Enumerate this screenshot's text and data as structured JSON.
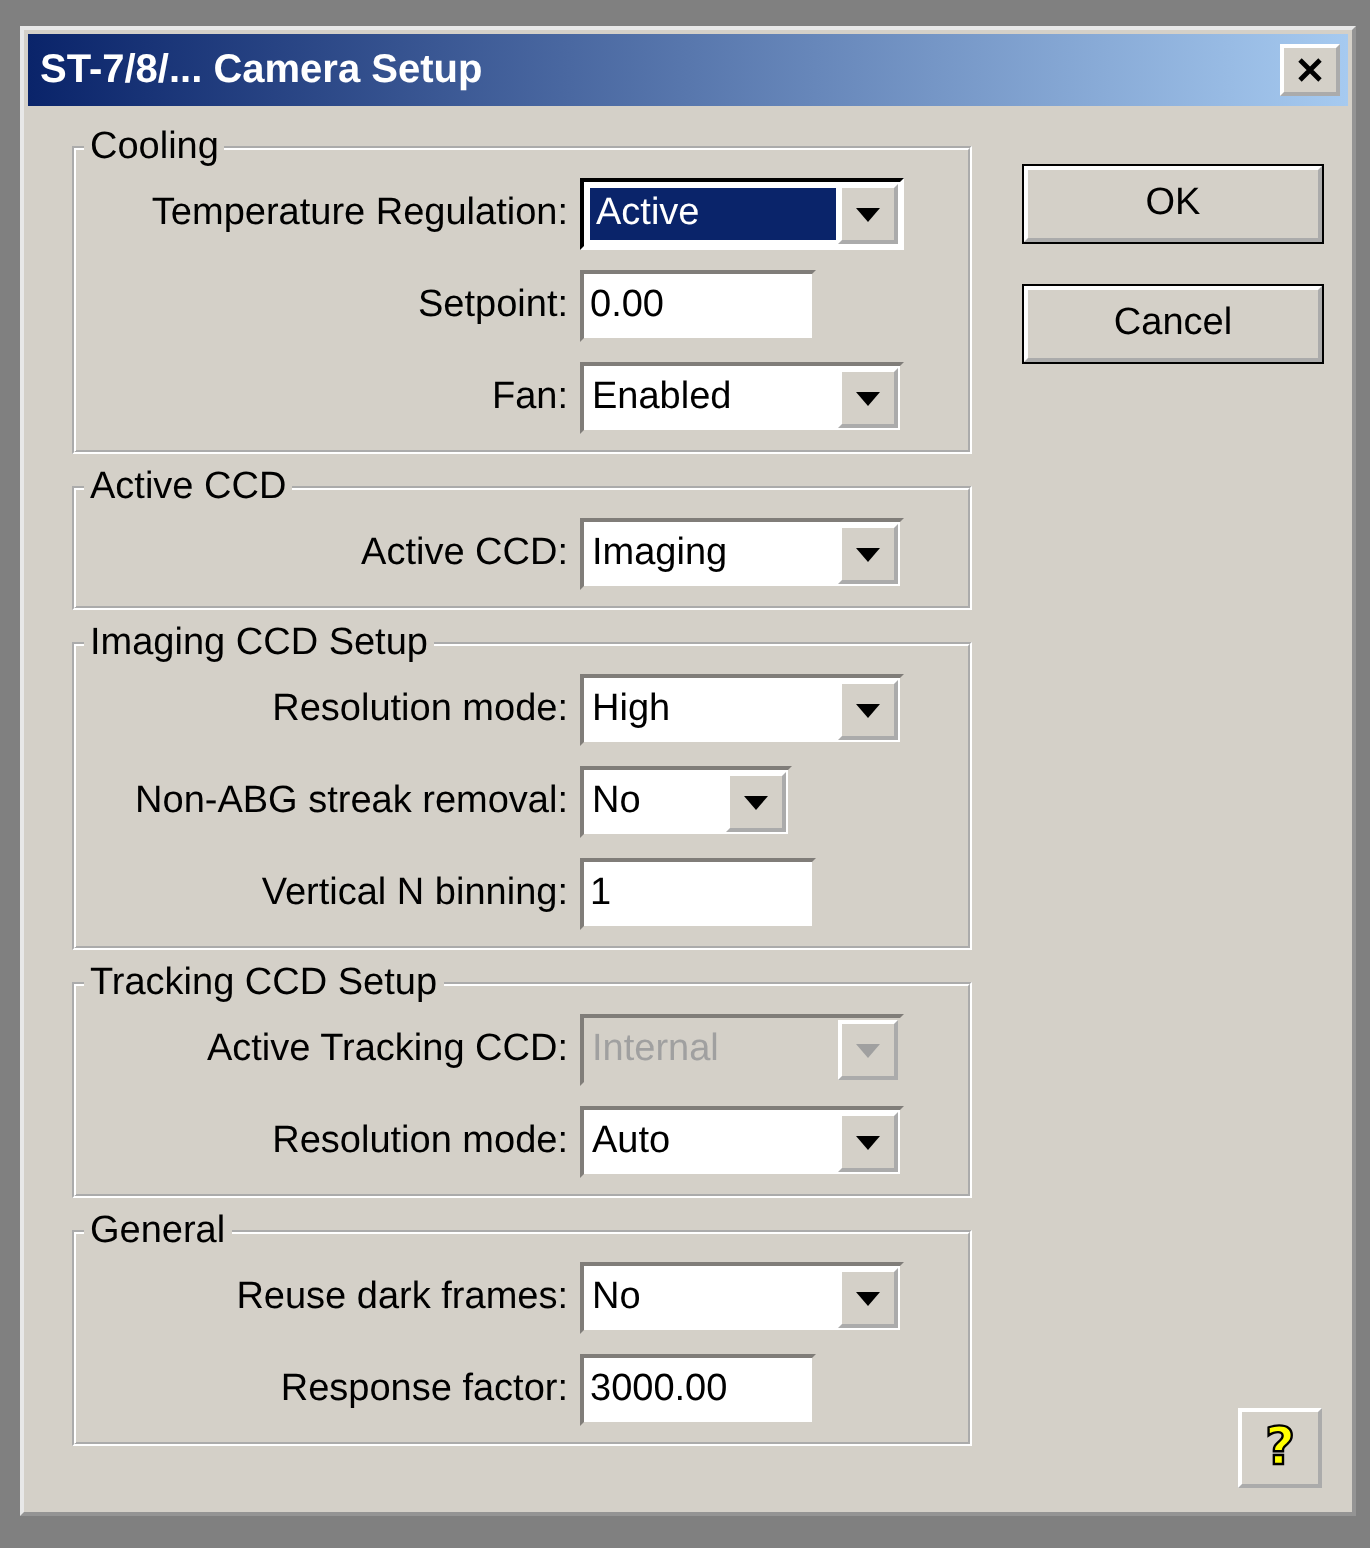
{
  "window": {
    "title": "ST-7/8/... Camera Setup"
  },
  "groups": [
    {
      "title": "Cooling",
      "fields": [
        {
          "label": "Temperature Regulation:",
          "kind": "combo",
          "value": "Active",
          "focused": true,
          "disabled": false
        },
        {
          "label": "Setpoint:",
          "kind": "text",
          "value": "0.00",
          "disabled": false
        },
        {
          "label": "Fan:",
          "kind": "combo",
          "value": "Enabled",
          "focused": false,
          "disabled": false
        }
      ]
    },
    {
      "title": "Active CCD",
      "fields": [
        {
          "label": "Active CCD:",
          "kind": "combo",
          "value": "Imaging",
          "focused": false,
          "disabled": false
        }
      ]
    },
    {
      "title": "Imaging CCD Setup",
      "fields": [
        {
          "label": "Resolution mode:",
          "kind": "combo",
          "value": "High",
          "focused": false,
          "disabled": false
        },
        {
          "label": "Non-ABG streak removal:",
          "kind": "small-combo",
          "value": "No",
          "focused": false,
          "disabled": false
        },
        {
          "label": "Vertical N binning:",
          "kind": "text",
          "value": "1",
          "disabled": false
        }
      ]
    },
    {
      "title": "Tracking CCD Setup",
      "fields": [
        {
          "label": "Active Tracking CCD:",
          "kind": "combo",
          "value": "Internal",
          "focused": false,
          "disabled": true
        },
        {
          "label": "Resolution mode:",
          "kind": "combo",
          "value": "Auto",
          "focused": false,
          "disabled": false
        }
      ]
    },
    {
      "title": "General",
      "fields": [
        {
          "label": "Reuse dark frames:",
          "kind": "combo",
          "value": "No",
          "focused": false,
          "disabled": false
        },
        {
          "label": "Response factor:",
          "kind": "text",
          "value": "3000.00",
          "disabled": false
        }
      ]
    }
  ],
  "buttons": [
    "OK",
    "Cancel"
  ],
  "help_button": {
    "label": "?"
  }
}
